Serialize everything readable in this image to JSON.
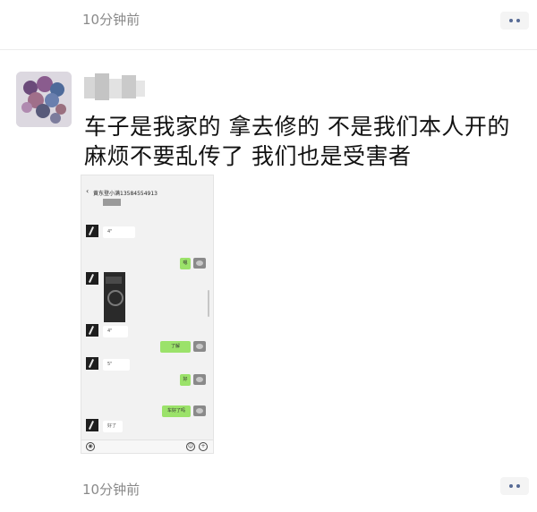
{
  "prev_post": {
    "time": "10分钟前"
  },
  "post": {
    "text_lines": [
      "车子是我家的 拿去修的 不是我们本人开的",
      "麻烦不要乱传了 我们也是受害者"
    ],
    "time": "10分钟前"
  },
  "screenshot": {
    "chat_title": "黄东登小满13584554913",
    "messages": [
      {
        "side": "left",
        "kind": "voice",
        "text": "4\""
      },
      {
        "side": "right",
        "kind": "text",
        "text": "嗯"
      },
      {
        "side": "left",
        "kind": "video"
      },
      {
        "side": "left",
        "kind": "voice",
        "text": "4\""
      },
      {
        "side": "right",
        "kind": "text",
        "text": "了解"
      },
      {
        "side": "left",
        "kind": "voice",
        "text": "5\""
      },
      {
        "side": "right",
        "kind": "text",
        "text": "好"
      },
      {
        "side": "right",
        "kind": "text",
        "text": "车好了吗"
      },
      {
        "side": "left",
        "kind": "text",
        "text": "好了"
      }
    ]
  },
  "icons": {
    "more": "more-dots-icon",
    "voice": "voice-icon",
    "emoji": "emoji-icon",
    "plus": "plus-icon",
    "back": "back-arrow-icon"
  },
  "colors": {
    "link": "#576b95",
    "sent_bubble": "#9be26a",
    "timestamp": "#8a8a8a"
  }
}
